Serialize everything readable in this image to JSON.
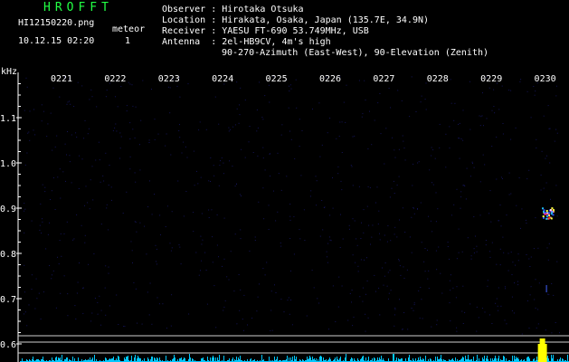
{
  "header": {
    "brand": "HROFFT",
    "filename": "HI12150220.png",
    "timestamp": "10.12.15 02:20",
    "meteor_label": "meteor",
    "meteor_count": "1",
    "observer_label": "Observer",
    "observer": "Hirotaka Otsuka",
    "location_label": "Location",
    "location": "Hirakata, Osaka, Japan (135.7E, 34.9N)",
    "receiver_label": "Receiver",
    "receiver": "YAESU FT-690 53.749MHz, USB",
    "antenna_label": "Antenna",
    "antenna": "2el-HB9CV, 4m's high",
    "antenna_line2": "90-270-Azimuth (East-West), 90-Elevation (Zenith)"
  },
  "chart_data": {
    "type": "heatmap",
    "ylabel": "kHz",
    "y_ticks": [
      "1.1",
      "1.0",
      "0.9",
      "0.8",
      "0.7",
      "0.6"
    ],
    "y_tick_values": [
      1.1,
      1.0,
      0.9,
      0.8,
      0.7,
      0.6
    ],
    "x_ticks": [
      "0221",
      "0222",
      "0223",
      "0224",
      "0225",
      "0226",
      "0227",
      "0228",
      "0229",
      "0230"
    ],
    "colors": {
      "background": "#000000",
      "noise": "#141458",
      "axis": "#ffffff",
      "baseline": "#00c8ff",
      "meteor": "#ff3030",
      "burst": "#ffff00"
    },
    "meteor_echo": {
      "time": "0230",
      "frequency_khz": 0.89
    }
  }
}
